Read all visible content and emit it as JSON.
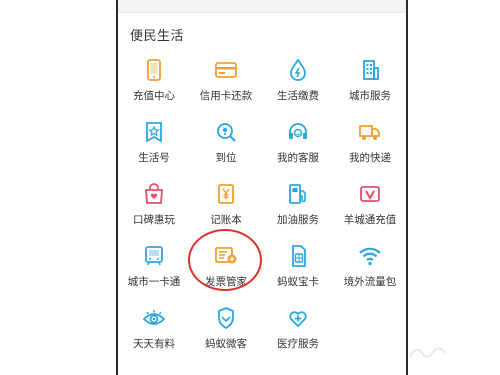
{
  "section": {
    "title": "便民生活"
  },
  "colors": {
    "orange": "#f0a030",
    "blue": "#2aa7e0",
    "highlight": "#d9342b"
  },
  "rows": [
    [
      {
        "label": "充值中心",
        "icon": "phone-icon"
      },
      {
        "label": "信用卡还款",
        "icon": "credit-card-icon"
      },
      {
        "label": "生活缴费",
        "icon": "water-drop-icon"
      },
      {
        "label": "城市服务",
        "icon": "building-icon"
      }
    ],
    [
      {
        "label": "生活号",
        "icon": "star-bookmark-icon"
      },
      {
        "label": "到位",
        "icon": "location-search-icon"
      },
      {
        "label": "我的客服",
        "icon": "headset-icon"
      },
      {
        "label": "我的快递",
        "icon": "truck-icon"
      }
    ],
    [
      {
        "label": "口碑惠玩",
        "icon": "shopping-bag-icon"
      },
      {
        "label": "记账本",
        "icon": "ledger-icon"
      },
      {
        "label": "加油服务",
        "icon": "fuel-pump-icon"
      },
      {
        "label": "羊城通充值",
        "icon": "v-card-icon"
      }
    ],
    [
      {
        "label": "城市一卡通",
        "icon": "city-card-icon"
      },
      {
        "label": "发票管家",
        "icon": "invoice-icon"
      },
      {
        "label": "蚂蚁宝卡",
        "icon": "sim-card-icon"
      },
      {
        "label": "境外流量包",
        "icon": "wifi-icon"
      }
    ],
    [
      {
        "label": "天天有料",
        "icon": "eye-icon"
      },
      {
        "label": "蚂蚁微客",
        "icon": "ant-shield-icon"
      },
      {
        "label": "医疗服务",
        "icon": "medical-icon"
      }
    ]
  ]
}
